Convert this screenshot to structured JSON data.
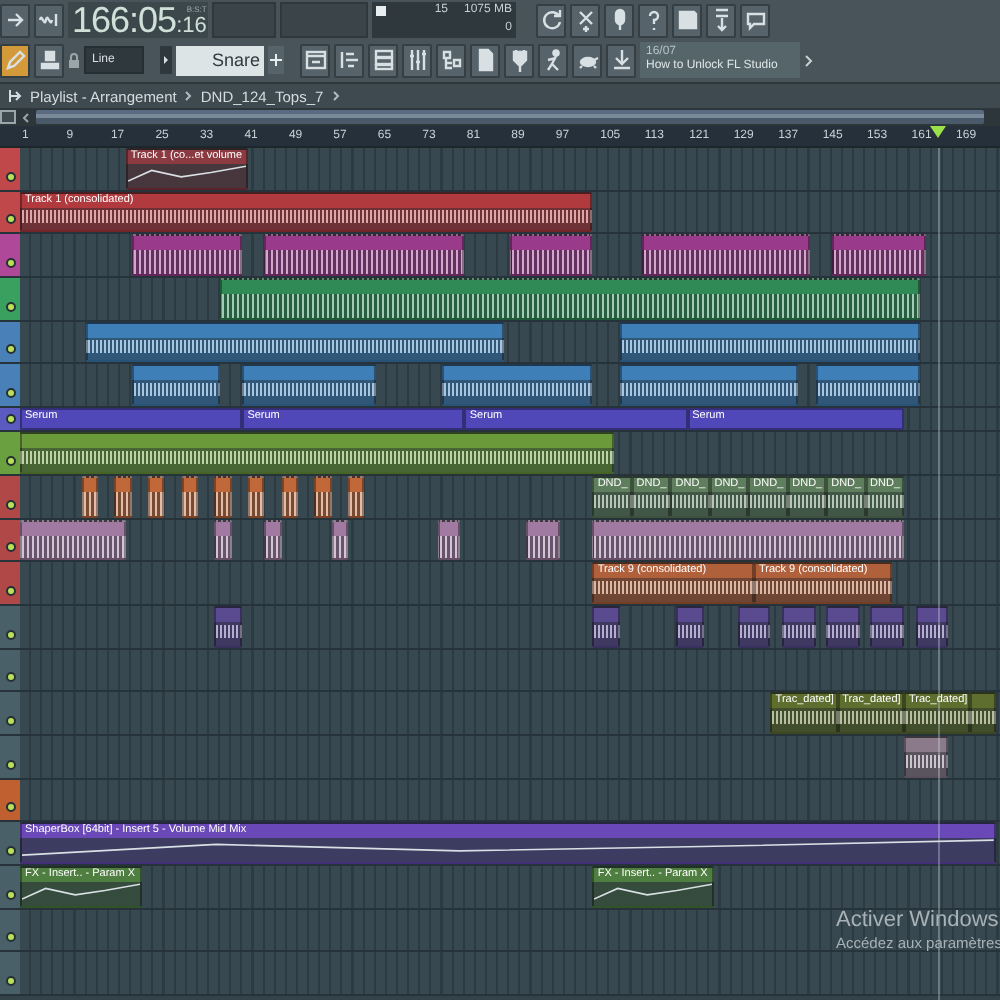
{
  "toolbar": {
    "time_main": "166:05",
    "time_sub": ":16",
    "time_format": "B:S:T",
    "cpu": "15",
    "memory": "1075 MB",
    "polyphony": "0",
    "snap": "Line",
    "tool_target": "Snare",
    "hint_date": "16/07",
    "hint_text": "How to Unlock FL Studio"
  },
  "breadcrumb": [
    "Playlist - Arrangement",
    "DND_124_Tops_7"
  ],
  "ruler": [
    "1",
    "9",
    "17",
    "25",
    "33",
    "41",
    "49",
    "57",
    "65",
    "73",
    "81",
    "89",
    "97",
    "105",
    "113",
    "121",
    "129",
    "137",
    "145",
    "153",
    "161",
    "169"
  ],
  "lanes": [
    {
      "color": "#c0484a",
      "active": true,
      "compact": false,
      "clips": [
        {
          "kind": "automation",
          "label": "Track 1 (co...et volume",
          "color": "#8a3a40"
        }
      ]
    },
    {
      "color": "#c0484a",
      "active": true,
      "compact": false,
      "clips": [
        {
          "kind": "audio",
          "label": "Track 1 (consolidated)",
          "color": "#b03a3e"
        }
      ]
    },
    {
      "color": "#b0489a",
      "active": true,
      "compact": false,
      "clips": [
        {
          "kind": "pattern",
          "color": "#9a3a8a"
        },
        {
          "kind": "pattern",
          "color": "#9a3a8a"
        },
        {
          "kind": "pattern",
          "color": "#9a3a8a"
        },
        {
          "kind": "pattern",
          "color": "#9a3a8a"
        },
        {
          "kind": "pattern",
          "color": "#9a3a8a"
        }
      ]
    },
    {
      "color": "#3aa060",
      "active": true,
      "compact": false,
      "clips": [
        {
          "kind": "pattern",
          "color": "#2f8a55"
        }
      ]
    },
    {
      "color": "#4a80b8",
      "active": true,
      "compact": false,
      "clips": [
        {
          "kind": "audio",
          "color": "#3f7fb8"
        },
        {
          "kind": "audio",
          "color": "#3f7fb8"
        }
      ]
    },
    {
      "color": "#4a80b8",
      "active": true,
      "compact": false,
      "clips": [
        {
          "kind": "audio",
          "color": "#3f7fb8"
        },
        {
          "kind": "audio",
          "color": "#3f7fb8"
        },
        {
          "kind": "audio",
          "color": "#3f7fb8"
        },
        {
          "kind": "audio",
          "color": "#3f7fb8"
        },
        {
          "kind": "audio",
          "color": "#3f7fb8"
        }
      ]
    },
    {
      "color": "#5a5ac0",
      "active": true,
      "compact": true,
      "clips": [
        {
          "kind": "pattern",
          "label": "Serum",
          "color": "#5048b8"
        },
        {
          "kind": "pattern",
          "label": "Serum",
          "color": "#5048b8"
        },
        {
          "kind": "pattern",
          "label": "Serum",
          "color": "#5048b8"
        },
        {
          "kind": "pattern",
          "label": "Serum",
          "color": "#5048b8"
        }
      ]
    },
    {
      "color": "#6aa040",
      "active": true,
      "compact": false,
      "clips": [
        {
          "kind": "audio",
          "color": "#6a9a3a"
        }
      ]
    },
    {
      "color": "#b04848",
      "active": true,
      "compact": false,
      "clips": [
        {
          "kind": "pattern",
          "color": "#c0683a"
        },
        {
          "kind": "pattern",
          "color": "#c0683a"
        },
        {
          "kind": "pattern",
          "color": "#c0683a"
        },
        {
          "kind": "pattern",
          "color": "#c0683a"
        },
        {
          "kind": "pattern",
          "color": "#c0683a"
        },
        {
          "kind": "pattern",
          "color": "#c0683a"
        },
        {
          "kind": "pattern",
          "color": "#c0683a"
        },
        {
          "kind": "pattern",
          "color": "#c0683a"
        },
        {
          "kind": "pattern",
          "color": "#c0683a"
        },
        {
          "kind": "audio",
          "label": "DND_",
          "color": "#5e7e5e"
        },
        {
          "kind": "audio",
          "label": "DND_",
          "color": "#5e7e5e"
        },
        {
          "kind": "audio",
          "label": "DND_",
          "color": "#5e7e5e"
        },
        {
          "kind": "audio",
          "label": "DND_",
          "color": "#5e7e5e"
        },
        {
          "kind": "audio",
          "label": "DND_",
          "color": "#5e7e5e"
        },
        {
          "kind": "audio",
          "label": "DND_",
          "color": "#5e7e5e"
        },
        {
          "kind": "audio",
          "label": "DND_",
          "color": "#5e7e5e"
        },
        {
          "kind": "audio",
          "label": "DND_",
          "color": "#5e7e5e"
        }
      ]
    },
    {
      "color": "#b04848",
      "active": true,
      "compact": false,
      "clips": [
        {
          "kind": "pattern",
          "color": "#a07aa0"
        },
        {
          "kind": "pattern",
          "color": "#a07aa0"
        },
        {
          "kind": "pattern",
          "color": "#a07aa0"
        },
        {
          "kind": "pattern",
          "color": "#a07aa0"
        },
        {
          "kind": "pattern",
          "color": "#a07aa0"
        },
        {
          "kind": "pattern",
          "color": "#a07aa0"
        },
        {
          "kind": "pattern",
          "color": "#a07aa0"
        }
      ]
    },
    {
      "color": "#b04848",
      "active": true,
      "compact": false,
      "clips": [
        {
          "kind": "audio",
          "label": "Track 9 (consolidated)",
          "color": "#b0603a"
        },
        {
          "kind": "audio",
          "label": "Track 9 (consolidated)",
          "color": "#b0603a"
        }
      ]
    },
    {
      "color": "#4a6068",
      "active": true,
      "compact": false,
      "clips": [
        {
          "kind": "audio",
          "color": "#5a4a90"
        },
        {
          "kind": "audio",
          "color": "#5a4a90"
        },
        {
          "kind": "audio",
          "color": "#5a4a90"
        },
        {
          "kind": "audio",
          "color": "#5a4a90"
        },
        {
          "kind": "audio",
          "color": "#5a4a90"
        },
        {
          "kind": "audio",
          "color": "#5a4a90"
        },
        {
          "kind": "audio",
          "color": "#5a4a90"
        },
        {
          "kind": "audio",
          "color": "#5a4a90"
        }
      ]
    },
    {
      "color": "#4a6068",
      "active": true,
      "compact": false
    },
    {
      "color": "#4a6068",
      "active": true,
      "compact": false,
      "clips": [
        {
          "kind": "audio",
          "label": "Trac_dated]",
          "color": "#5e6e2e"
        },
        {
          "kind": "audio",
          "label": "Trac_dated]",
          "color": "#5e6e2e"
        },
        {
          "kind": "audio",
          "label": "Trac_dated]",
          "color": "#5e6e2e"
        },
        {
          "kind": "audio",
          "color": "#5e6e2e"
        }
      ]
    },
    {
      "color": "#4a6068",
      "active": true,
      "compact": false,
      "clips": [
        {
          "kind": "audio",
          "color": "#8a7a8a"
        }
      ]
    },
    {
      "color": "#c06030",
      "active": true,
      "compact": false
    },
    {
      "color": "#4a6068",
      "active": true,
      "compact": false,
      "clips": [
        {
          "kind": "automation",
          "label": "ShaperBox [64bit] - Insert 5 - Volume Mid Mix",
          "color": "#6a48b8"
        }
      ]
    },
    {
      "color": "#4a6068",
      "active": true,
      "compact": false,
      "clips": [
        {
          "kind": "automation",
          "label": "FX - Insert.. - Param X",
          "color": "#4e7e40"
        },
        {
          "kind": "automation",
          "label": "FX - Insert.. - Param X",
          "color": "#4e7e40"
        }
      ]
    },
    {
      "color": "#4a6068",
      "active": true,
      "compact": false
    },
    {
      "color": "#4a6068",
      "active": true,
      "compact": false
    }
  ],
  "os_notice": {
    "title": "Activer Windows",
    "text": "Accédez aux paramètres"
  }
}
